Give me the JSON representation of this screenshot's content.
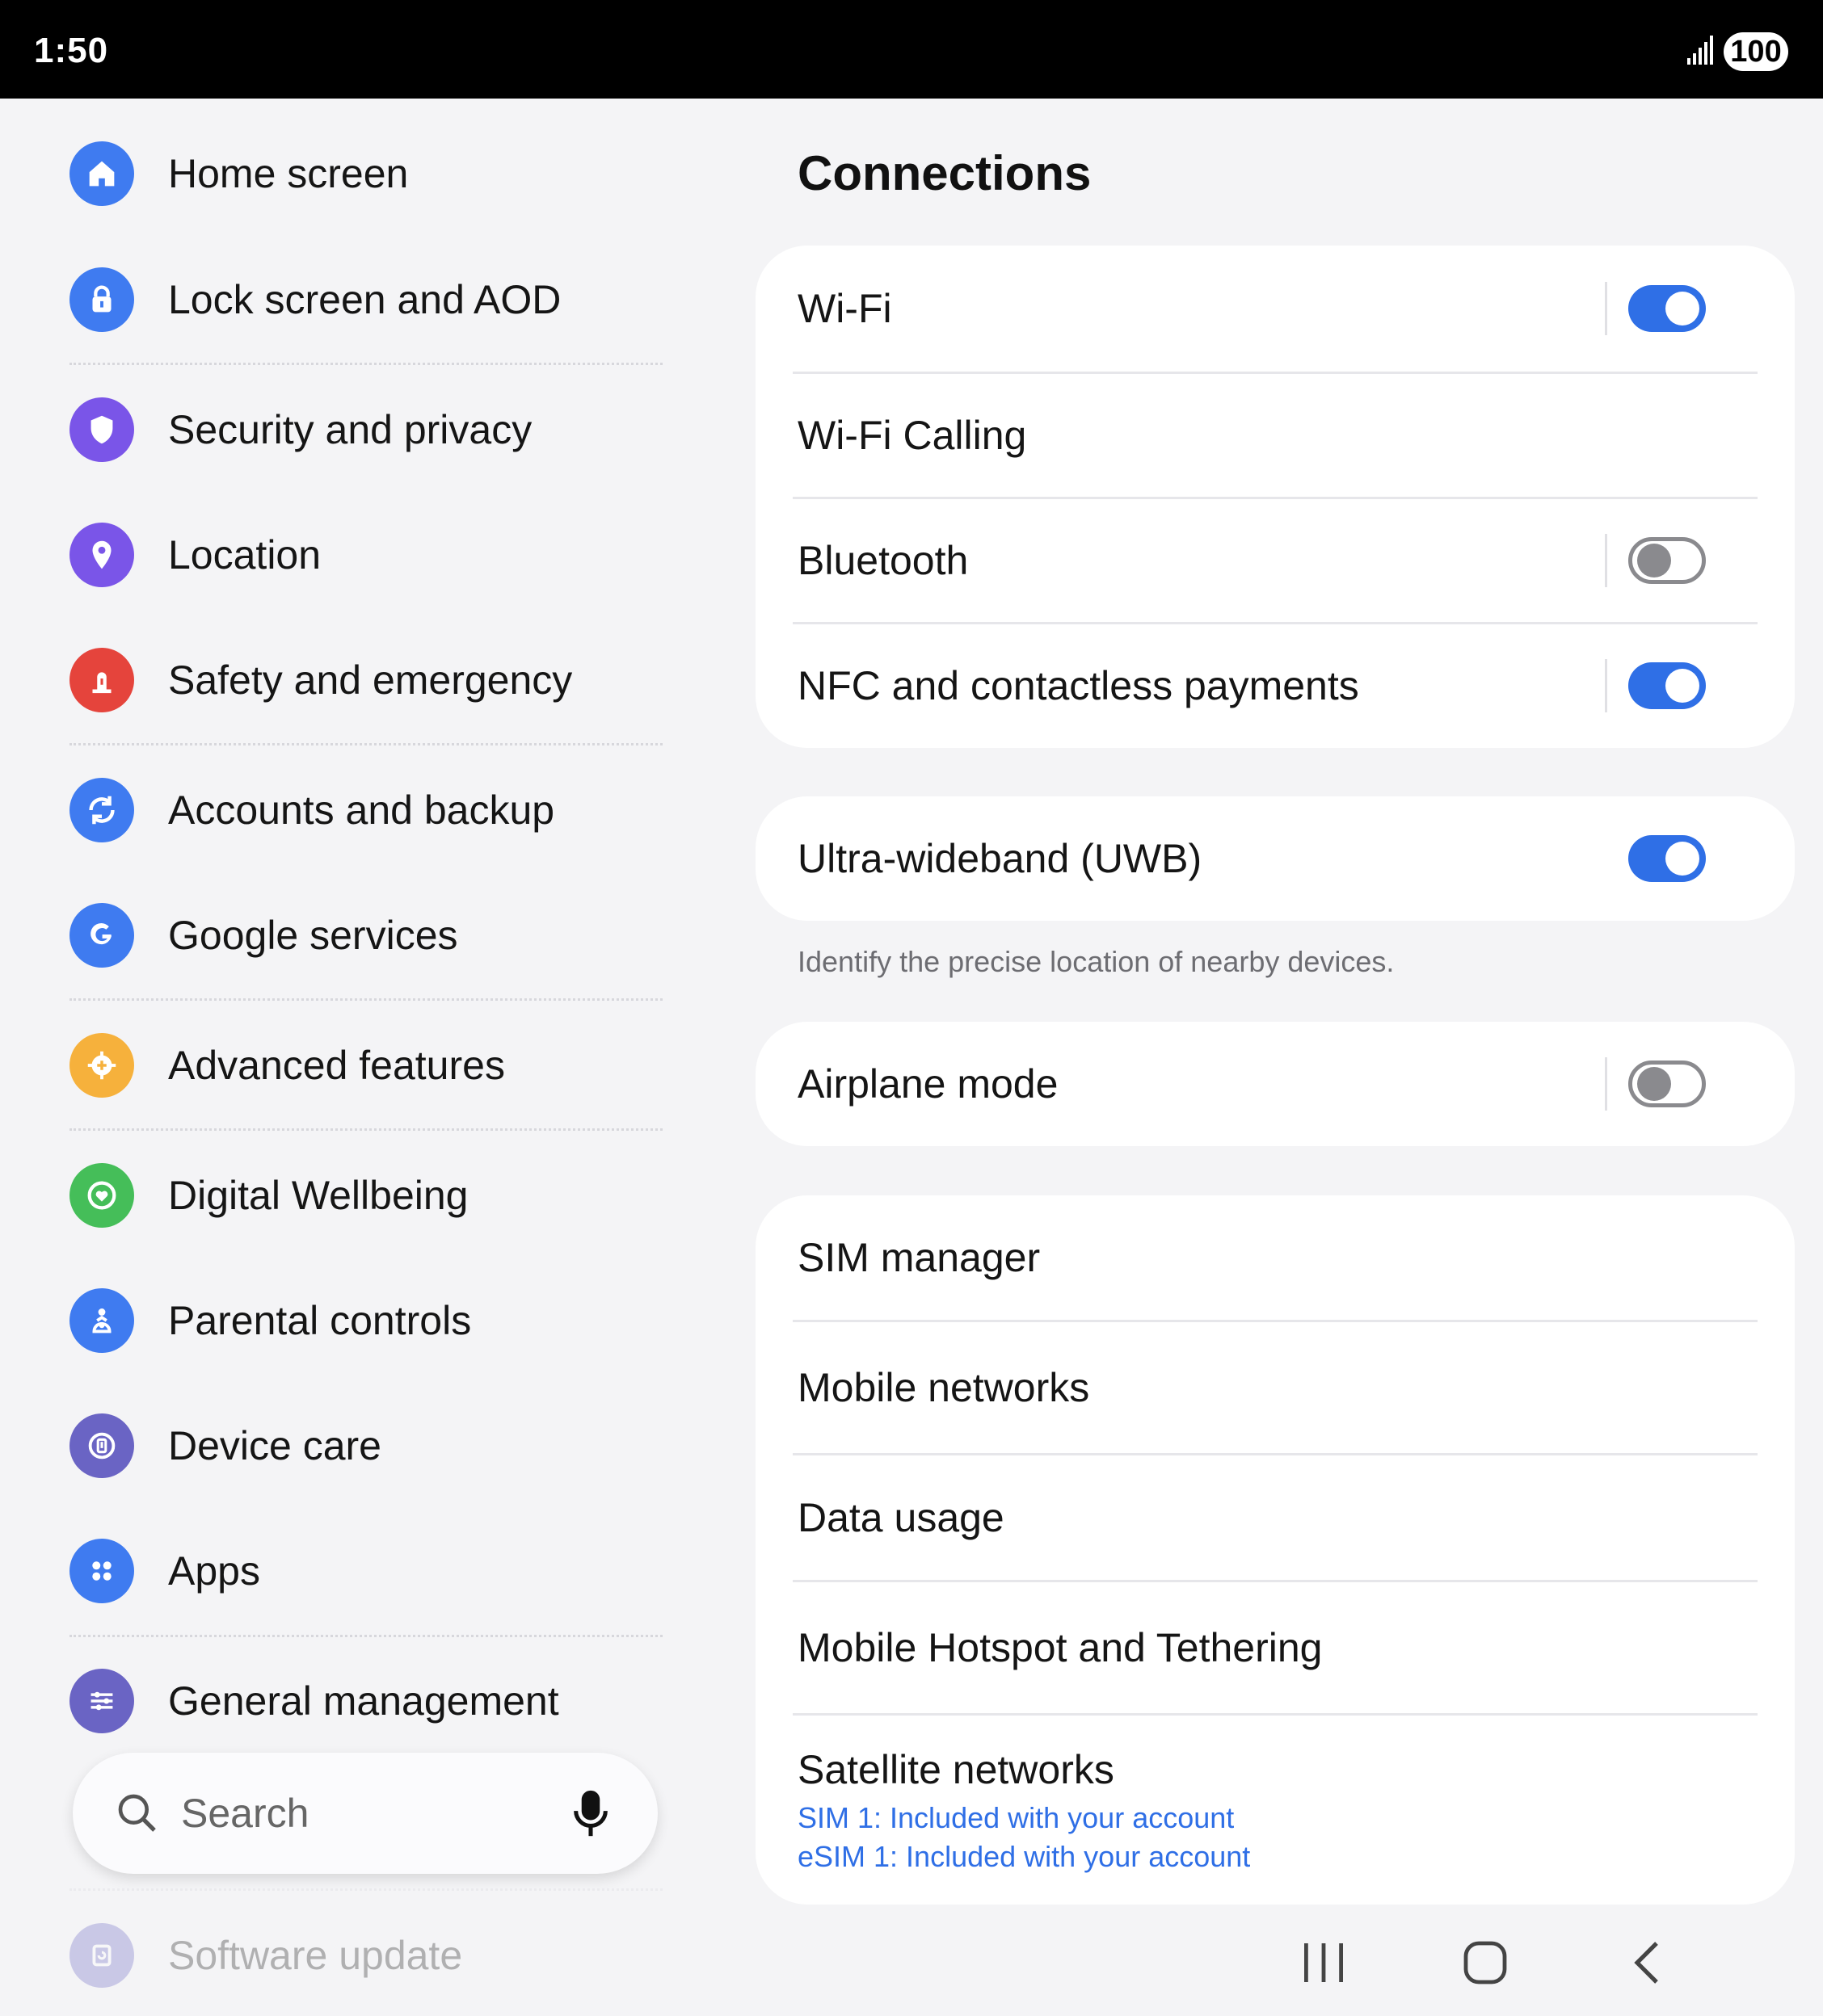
{
  "status_bar": {
    "time": "1:50",
    "battery": "100"
  },
  "sidebar": {
    "items": [
      {
        "label": "Home screen",
        "icon": "home-icon",
        "color": "#3f7bf0"
      },
      {
        "label": "Lock screen and AOD",
        "icon": "lock-icon",
        "color": "#3f7bf0"
      },
      {
        "label": "Security and privacy",
        "icon": "shield-icon",
        "color": "#7a55e8"
      },
      {
        "label": "Location",
        "icon": "location-pin-icon",
        "color": "#7a55e8"
      },
      {
        "label": "Safety and emergency",
        "icon": "alert-icon",
        "color": "#e5443c"
      },
      {
        "label": "Accounts and backup",
        "icon": "sync-icon",
        "color": "#3f7bf0"
      },
      {
        "label": "Google services",
        "icon": "google-icon",
        "color": "#3f7bf0"
      },
      {
        "label": "Advanced features",
        "icon": "gear-plus-icon",
        "color": "#f6b13c"
      },
      {
        "label": "Digital Wellbeing",
        "icon": "heart-circle-icon",
        "color": "#45be59"
      },
      {
        "label": "Parental controls",
        "icon": "parent-child-icon",
        "color": "#3f7bf0"
      },
      {
        "label": "Device care",
        "icon": "device-care-icon",
        "color": "#6a64c4"
      },
      {
        "label": "Apps",
        "icon": "apps-grid-icon",
        "color": "#3f7bf0"
      },
      {
        "label": "General management",
        "icon": "sliders-icon",
        "color": "#6a64c4"
      },
      {
        "label": "Software update",
        "icon": "update-icon",
        "color": "#6a64c4"
      }
    ],
    "search": {
      "placeholder": "Search"
    }
  },
  "main": {
    "title": "Connections",
    "group1": [
      {
        "label": "Wi-Fi",
        "toggle": true
      },
      {
        "label": "Wi-Fi Calling"
      },
      {
        "label": "Bluetooth",
        "toggle": false
      },
      {
        "label": "NFC and contactless payments",
        "toggle": true
      }
    ],
    "uwb": {
      "label": "Ultra-wideband (UWB)",
      "toggle": true,
      "helper": "Identify the precise location of nearby devices."
    },
    "airplane": {
      "label": "Airplane mode",
      "toggle": false
    },
    "group3": [
      {
        "label": "SIM manager"
      },
      {
        "label": "Mobile networks"
      },
      {
        "label": "Data usage"
      },
      {
        "label": "Mobile Hotspot and Tethering"
      },
      {
        "label": "Satellite networks",
        "sub1": "SIM 1: Included with your account",
        "sub2": "eSIM 1: Included with your account"
      }
    ]
  },
  "colors": {
    "accent": "#2f6fe6",
    "toggle_off": "#8a8a8e"
  }
}
